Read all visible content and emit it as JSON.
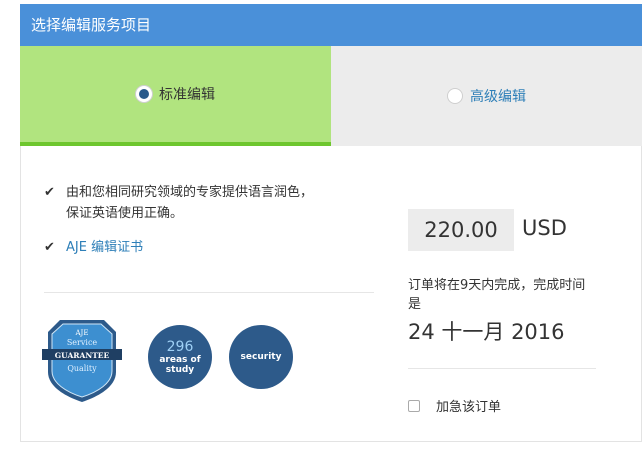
{
  "header": {
    "title": "选择编辑服务项目"
  },
  "tabs": [
    {
      "label": "标准编辑",
      "selected": true
    },
    {
      "label": "高级编辑",
      "selected": false
    }
  ],
  "features": {
    "line1": "由和您相同研究领域的专家提供语言润色，",
    "line2": "保证英语使用正确。",
    "certificate_link": "AJE 编辑证书"
  },
  "badges": {
    "shield": {
      "top": "AJE",
      "lines": [
        "Service",
        "GUARANTEE",
        "Quality"
      ]
    },
    "areas": {
      "number": "296",
      "line1": "areas of",
      "line2": "study"
    },
    "security": {
      "label": "security"
    }
  },
  "pricing": {
    "amount": "220.00",
    "currency": "USD",
    "note": "订单将在9天内完成，完成时间是",
    "date": "24 十一月 2016"
  },
  "rush": {
    "label": "加急该订单",
    "checked": false
  },
  "colors": {
    "header": "#4a90d9",
    "selected_tab": "#b1e47f",
    "badge": "#2d5a8a",
    "link": "#2e7fb8"
  }
}
